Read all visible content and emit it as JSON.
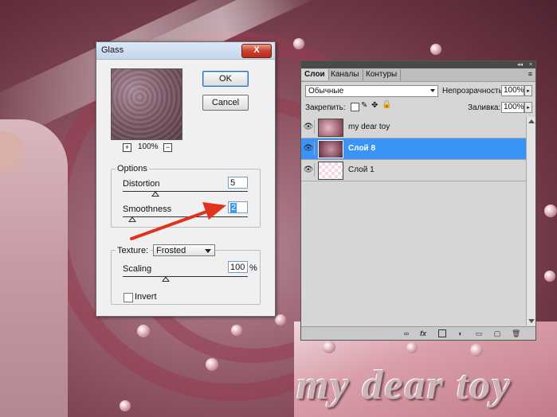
{
  "background": {
    "watermark": "my dear toy"
  },
  "dialog": {
    "title": "Glass",
    "close_label": "X",
    "zoom_in": "+",
    "zoom_out": "−",
    "zoom_level": "100%",
    "ok_label": "OK",
    "cancel_label": "Cancel",
    "options_label": "Options",
    "distortion_label": "Distortion",
    "distortion_value": "5",
    "smoothness_label": "Smoothness",
    "smoothness_value": "2",
    "texture_label": "Texture:",
    "texture_value": "Frosted",
    "scaling_label": "Scaling",
    "scaling_value": "100",
    "scaling_unit": "%",
    "invert_label": "Invert",
    "invert_checked": false
  },
  "layers_panel": {
    "collapse_label": "◂◂",
    "close_label": "×",
    "tabs": [
      "Слои",
      "Каналы",
      "Контуры"
    ],
    "active_tab": "Слои",
    "menu_icon": "≡",
    "blend_mode": "Обычные",
    "opacity_label": "Непрозрачность:",
    "opacity_value": "100%",
    "lock_label": "Закрепить:",
    "fill_label": "Заливка:",
    "fill_value": "100%",
    "layers": [
      {
        "name": "my dear toy",
        "selected": false
      },
      {
        "name": "Слой 8",
        "selected": true
      },
      {
        "name": "Слой 1",
        "selected": false
      }
    ],
    "footer_icons": [
      "link-icon",
      "fx-icon",
      "mask-icon",
      "adjustment-icon",
      "folder-icon",
      "new-layer-icon",
      "trash-icon"
    ]
  },
  "colors": {
    "accent_selection": "#3a94f5",
    "annotation_arrow": "#e0321c"
  }
}
